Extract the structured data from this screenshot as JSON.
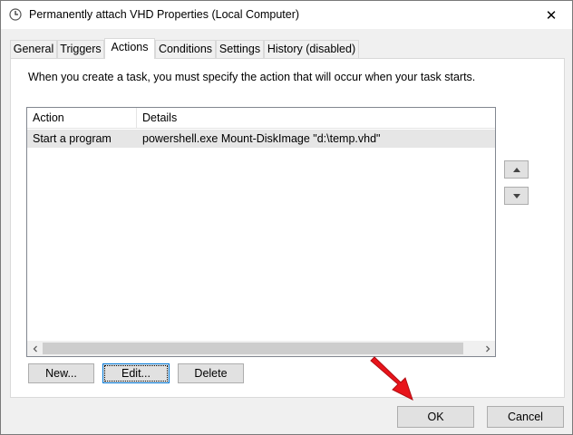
{
  "window": {
    "title": "Permanently attach VHD Properties (Local Computer)",
    "close_symbol": "✕"
  },
  "tabs": [
    {
      "label": "General",
      "active": false
    },
    {
      "label": "Triggers",
      "active": false
    },
    {
      "label": "Actions",
      "active": true
    },
    {
      "label": "Conditions",
      "active": false
    },
    {
      "label": "Settings",
      "active": false
    },
    {
      "label": "History (disabled)",
      "active": false
    }
  ],
  "panel": {
    "intro": "When you create a task, you must specify the action that will occur when your task starts.",
    "columns": [
      "Action",
      "Details"
    ],
    "rows": [
      {
        "action": "Start a program",
        "details": "powershell.exe Mount-DiskImage \"d:\\temp.vhd\""
      }
    ],
    "buttons": {
      "new": "New...",
      "edit": "Edit...",
      "delete": "Delete"
    }
  },
  "footer": {
    "ok": "OK",
    "cancel": "Cancel"
  },
  "colors": {
    "annotation_arrow": "#e8141b",
    "focus_border": "#0078d7"
  },
  "icons": {
    "title": "clock-icon",
    "move_up": "caret-up-icon",
    "move_down": "caret-down-icon",
    "scroll_left": "chevron-left-icon",
    "scroll_right": "chevron-right-icon"
  }
}
